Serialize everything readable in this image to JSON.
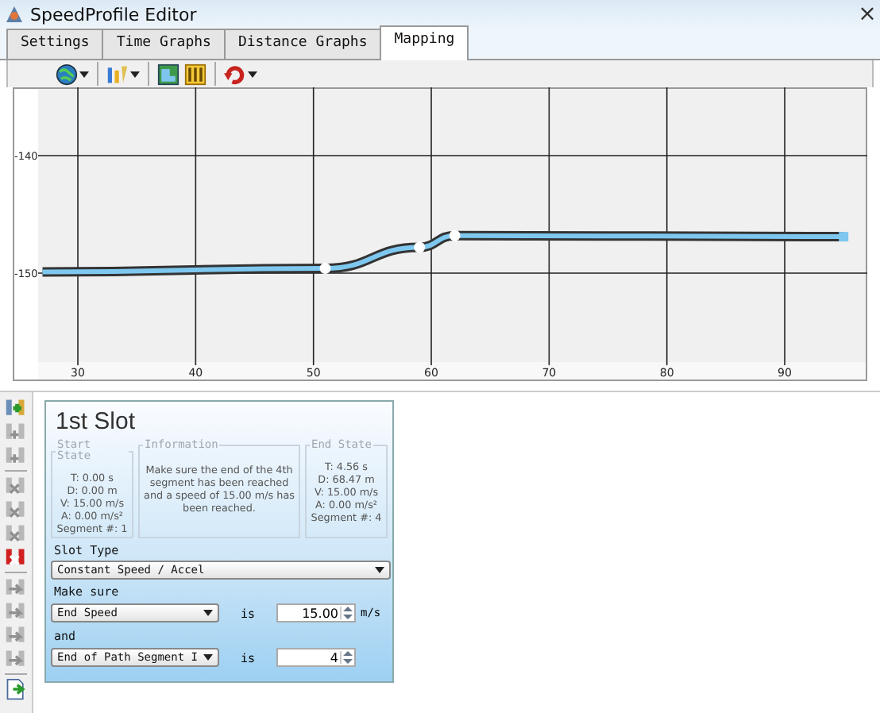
{
  "window": {
    "title": "SpeedProfile Editor",
    "close": "×"
  },
  "tabs": [
    {
      "label": "Settings",
      "selected": false
    },
    {
      "label": "Time Graphs",
      "selected": false
    },
    {
      "label": "Distance Graphs",
      "selected": false
    },
    {
      "label": "Mapping",
      "selected": true
    }
  ],
  "toolbar": [
    {
      "kind": "globe",
      "caret": true
    },
    {
      "kind": "sep"
    },
    {
      "kind": "bars-pen",
      "caret": true
    },
    {
      "kind": "sep"
    },
    {
      "kind": "map",
      "caret": false
    },
    {
      "kind": "bars",
      "caret": false
    },
    {
      "kind": "sep"
    },
    {
      "kind": "undo",
      "caret": true
    }
  ],
  "chart_data": {
    "type": "line",
    "x": [
      27,
      51,
      59,
      62,
      95
    ],
    "grid": true,
    "series": [
      {
        "color": "#7ec8f0",
        "marker": "circle",
        "values": [
          -149.9,
          -149.6,
          -147.8,
          -146.8,
          -146.9
        ]
      }
    ],
    "xlim": [
      24.47,
      97.01
    ],
    "ylim": [
      -159.19,
      -134.19
    ],
    "xticks": [
      30,
      40,
      50,
      60,
      70,
      80,
      90
    ],
    "yticks": [
      -140,
      -150
    ]
  },
  "side_tools": [
    {
      "kind": "add-color"
    },
    {
      "kind": "add"
    },
    {
      "kind": "add"
    },
    {
      "kind": "sep"
    },
    {
      "kind": "remove"
    },
    {
      "kind": "remove"
    },
    {
      "kind": "remove"
    },
    {
      "kind": "remove-red"
    },
    {
      "kind": "sep"
    },
    {
      "kind": "move"
    },
    {
      "kind": "move"
    },
    {
      "kind": "move"
    },
    {
      "kind": "move"
    },
    {
      "kind": "sep"
    },
    {
      "kind": "export"
    }
  ],
  "slot": {
    "title": "1st Slot",
    "start_state": {
      "legend": "Start State",
      "lines": [
        "T: 0.00 s",
        "D: 0.00 m",
        "V: 15.00 m/s",
        "A: 0.00 m/s²",
        "Segment #: 1"
      ]
    },
    "information": {
      "legend": "Information",
      "text": "Make sure the end of the 4th segment has been reached and a speed of 15.00 m/s has been reached."
    },
    "end_state": {
      "legend": "End State",
      "lines": [
        "T: 4.56 s",
        "D: 68.47 m",
        "V: 15.00 m/s",
        "A: 0.00 m/s²",
        "Segment #: 4"
      ]
    },
    "slot_type_label": "Slot Type",
    "slot_type": "Constant Speed / Accel",
    "make_sure_label": "Make sure",
    "conditions": [
      {
        "field": "End Speed",
        "is": "is",
        "value": "15.00",
        "unit": "m/s"
      },
      {
        "join": "and",
        "field": "End of Path Segment I",
        "is": "is",
        "value": "4"
      }
    ]
  }
}
